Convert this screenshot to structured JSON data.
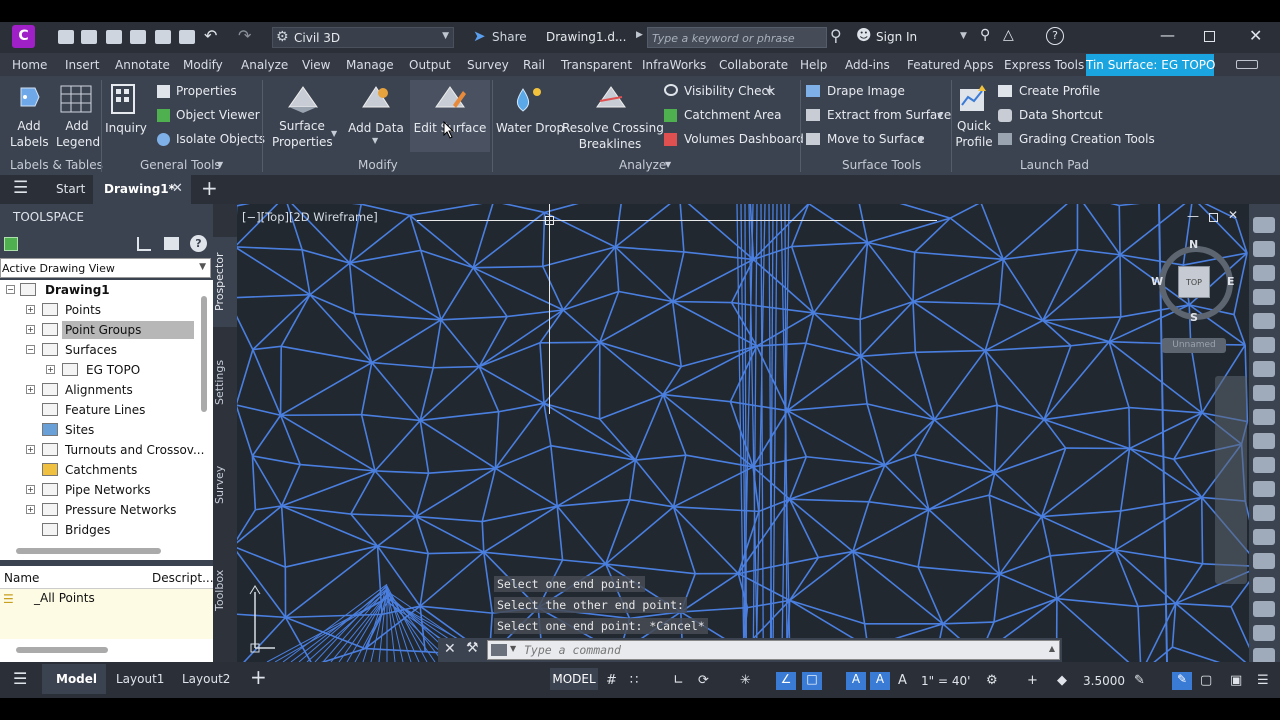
{
  "app": {
    "logo_letter": "C",
    "workspace": "Civil 3D",
    "share_label": "Share",
    "drawing_title": "Drawing1.d...",
    "search_placeholder": "Type a keyword or phrase",
    "sign_in": "Sign In",
    "accent": "#3a7bd5",
    "logo_color": "#a020c8"
  },
  "menu": {
    "items": [
      "Home",
      "Insert",
      "Annotate",
      "Modify",
      "Analyze",
      "View",
      "Manage",
      "Output",
      "Survey",
      "Rail",
      "Transparent",
      "InfraWorks",
      "Collaborate",
      "Help",
      "Add-ins",
      "Featured Apps",
      "Express Tools"
    ],
    "context_tab": "Tin Surface: EG TOPO"
  },
  "ribbon": {
    "add_labels": [
      "Add",
      "Labels"
    ],
    "add_legend": [
      "Add",
      "Legend"
    ],
    "labels_tables": "Labels & Tables",
    "inquiry": "Inquiry",
    "properties": "Properties",
    "object_viewer": "Object Viewer",
    "isolate_objects": "Isolate Objects",
    "general_tools": "General Tools",
    "surface_properties": [
      "Surface",
      "Properties"
    ],
    "add_data": "Add Data",
    "edit_surface": "Edit Surface",
    "modify": "Modify",
    "water_drop": "Water Drop",
    "resolve_crossing": [
      "Resolve Crossing",
      "Breaklines"
    ],
    "visibility_check": "Visibility Check",
    "catchment_area": "Catchment Area",
    "volumes_dashboard": "Volumes Dashboard",
    "analyze": "Analyze",
    "drape_image": "Drape Image",
    "extract_from_surface": "Extract from Surface",
    "move_to_surface": "Move to Surface",
    "surface_tools": "Surface Tools",
    "quick_profile": [
      "Quick",
      "Profile"
    ],
    "create_profile": "Create Profile",
    "data_shortcut": "Data Shortcut",
    "grading_creation_tools": "Grading Creation Tools",
    "launch_pad": "Launch Pad"
  },
  "doc_tabs": {
    "start": "Start",
    "drawing": "Drawing1*"
  },
  "toolspace": {
    "title": "TOOLSPACE",
    "view_select": "Active Drawing View",
    "tree": [
      {
        "label": "Drawing1",
        "level": 0
      },
      {
        "label": "Points",
        "level": 1
      },
      {
        "label": "Point Groups",
        "level": 1,
        "selected": true
      },
      {
        "label": "Surfaces",
        "level": 1
      },
      {
        "label": "EG TOPO",
        "level": 2
      },
      {
        "label": "Alignments",
        "level": 1
      },
      {
        "label": "Feature Lines",
        "level": 1
      },
      {
        "label": "Sites",
        "level": 1
      },
      {
        "label": "Turnouts and Crossov...",
        "level": 1
      },
      {
        "label": "Catchments",
        "level": 1
      },
      {
        "label": "Pipe Networks",
        "level": 1
      },
      {
        "label": "Pressure Networks",
        "level": 1
      },
      {
        "label": "Bridges",
        "level": 1
      }
    ],
    "list_headers": [
      "Name",
      "Descript..."
    ],
    "list_rows": [
      "_All Points"
    ],
    "side_tabs": [
      "Prospector",
      "Settings",
      "Survey",
      "Toolbox"
    ]
  },
  "viewport": {
    "label": "[−][Top][2D Wireframe]",
    "viewcube": {
      "n": "N",
      "s": "S",
      "e": "E",
      "w": "W",
      "top": "TOP",
      "ucs": "Unnamed"
    },
    "history": [
      "Select one end point:",
      "Select the other end point:",
      "Select one end point: *Cancel*"
    ],
    "command_placeholder": "Type a command",
    "mesh_color": "#4a7fe0"
  },
  "statusbar": {
    "tabs": [
      "Model",
      "Layout1",
      "Layout2"
    ],
    "model_button": "MODEL",
    "scale": "1\" = 40'",
    "elevation": "3.5000"
  }
}
